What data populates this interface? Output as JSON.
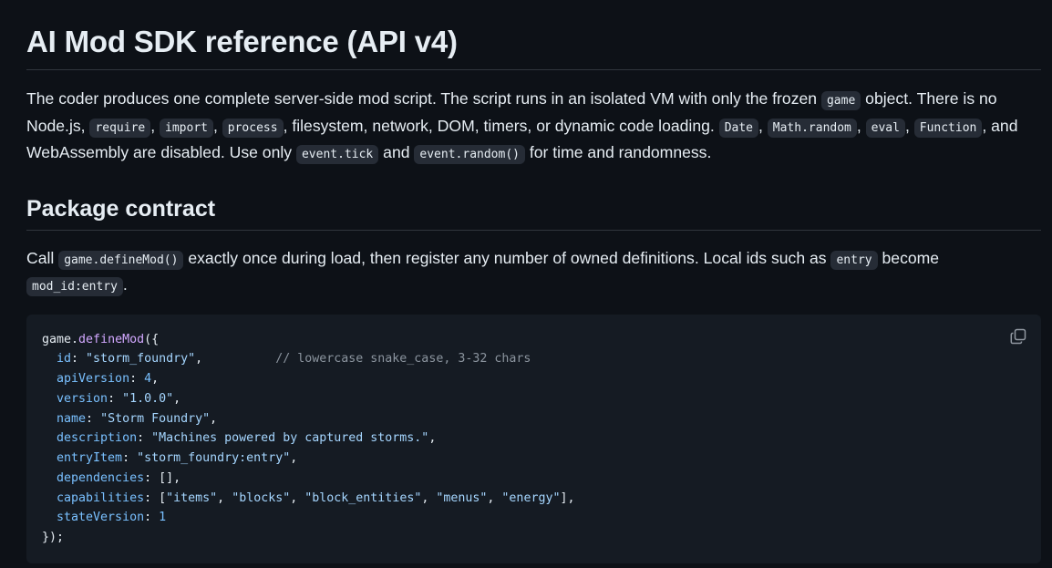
{
  "title": "AI Mod SDK reference (API v4)",
  "intro": {
    "t1": "The coder produces one complete server-side mod script. The script runs in an isolated VM with only the frozen ",
    "c1": "game",
    "t2": " object. There is no Node.js, ",
    "c2": "require",
    "t3": ", ",
    "c3": "import",
    "t4": ", ",
    "c4": "process",
    "t5": ", filesystem, network, DOM, timers, or dynamic code loading. ",
    "c5": "Date",
    "t6": ", ",
    "c6": "Math.random",
    "t7": ", ",
    "c7": "eval",
    "t8": ", ",
    "c8": "Function",
    "t9": ", and WebAssembly are disabled. Use only ",
    "c9": "event.tick",
    "t10": " and ",
    "c10": "event.random()",
    "t11": " for time and randomness."
  },
  "section": {
    "heading": "Package contract",
    "t1": "Call ",
    "c1": "game.defineMod()",
    "t2": " exactly once during load, then register any number of owned definitions. Local ids such as ",
    "c2": "entry",
    "t3": " become ",
    "c3": "mod_id:entry",
    "t4": "."
  },
  "code": {
    "copy_icon": "copy-icon",
    "l1_obj": "game",
    "l1_dot": ".",
    "l1_fn": "defineMod",
    "l1_open": "({",
    "id_key": "id",
    "id_val": "\"storm_foundry\"",
    "id_comment": "// lowercase snake_case, 3-32 chars",
    "api_key": "apiVersion",
    "api_val": "4",
    "ver_key": "version",
    "ver_val": "\"1.0.0\"",
    "name_key": "name",
    "name_val": "\"Storm Foundry\"",
    "desc_key": "description",
    "desc_val": "\"Machines powered by captured storms.\"",
    "entry_key": "entryItem",
    "entry_val": "\"storm_foundry:entry\"",
    "deps_key": "dependencies",
    "deps_val": "[]",
    "caps_key": "capabilities",
    "caps_v1": "\"items\"",
    "caps_v2": "\"blocks\"",
    "caps_v3": "\"block_entities\"",
    "caps_v4": "\"menus\"",
    "caps_v5": "\"energy\"",
    "state_key": "stateVersion",
    "state_val": "1",
    "close": "});"
  }
}
